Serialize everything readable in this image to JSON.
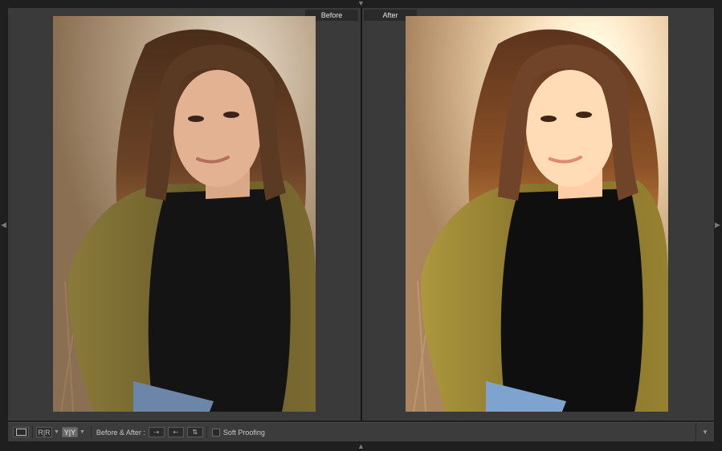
{
  "panels": {
    "before_label": "Before",
    "after_label": "After"
  },
  "photo": {
    "subject": "portrait-woman-olive-fur-coat",
    "before_state": "original",
    "after_state": "edited"
  },
  "toolbar": {
    "view_loupe_icon": "single-view-icon",
    "view_rr_label": "R|R",
    "view_yy_label": "Y|Y",
    "before_after_label": "Before & After :",
    "copy_before_to_after_icon": "copy-before-to-after-icon",
    "copy_after_to_before_icon": "copy-after-to-before-icon",
    "swap_icon": "swap-icon",
    "soft_proofing_label": "Soft Proofing",
    "soft_proofing_checked": false,
    "menu_icon": "chevron-down-icon"
  },
  "panel_arrows": {
    "top": "triangle-down",
    "bottom": "triangle-up",
    "left": "triangle-left",
    "right": "triangle-right"
  },
  "colors": {
    "background": "#1f1f1f",
    "panel": "#3a3a3a",
    "toolbar": "#3c3c3c",
    "coat": "#6b5e2a",
    "hair": "#5a3a22",
    "top": "#141414",
    "jeans": "#6b86a8"
  }
}
